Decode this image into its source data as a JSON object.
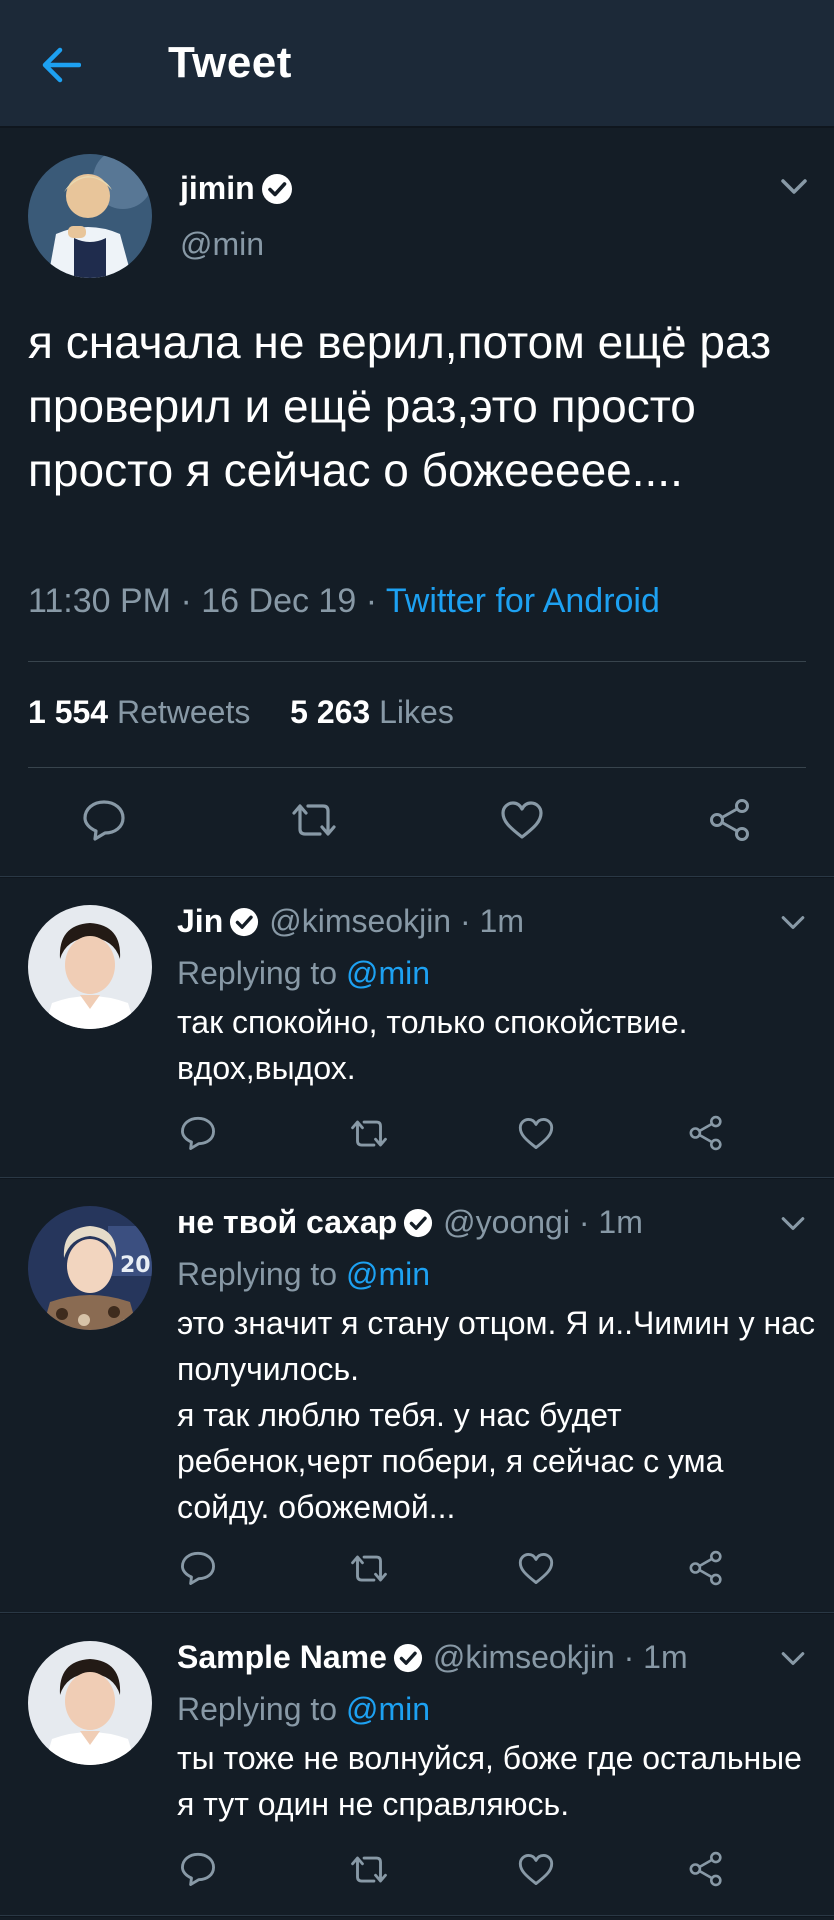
{
  "header": {
    "title": "Tweet"
  },
  "main_tweet": {
    "name": "jimin",
    "handle": "@min",
    "text": "я сначала не верил,потом ещё раз проверил и ещё раз,это просто просто я сейчас о божеееее....",
    "time": "11:30 PM",
    "date": "16 Dec 19",
    "separator": "·",
    "source": "Twitter for Android",
    "retweets_count": "1 554",
    "retweets_label": "Retweets",
    "likes_count": "5 263",
    "likes_label": "Likes"
  },
  "replies": [
    {
      "name": "Jin",
      "handle": "@kimseokjin · 1m",
      "replying_to_label": "Replying to",
      "replying_to": "@min",
      "lines": [
        "так спокойно, только спокойствие. вдох,выдох."
      ]
    },
    {
      "name": "не твой сахар",
      "handle": "@yoongi · 1m",
      "replying_to_label": "Replying to",
      "replying_to": "@min",
      "lines": [
        "это значит я стану отцом. Я и..Чимин у нас получилось.",
        "я так люблю тебя. у нас будет ребенок,черт побери, я сейчас с ума сойду. обожемой..."
      ]
    },
    {
      "name": "Sample Name",
      "handle": "@kimseokjin · 1m",
      "replying_to_label": "Replying to",
      "replying_to": "@min",
      "lines": [
        "ты тоже не волнуйся, боже где остальные я тут один не справляюсь."
      ]
    }
  ],
  "colors": {
    "background": "#141d26",
    "header": "#1c2938",
    "accent": "#1da1f2",
    "secondary_text": "#8899a6"
  },
  "icons": [
    "arrow-left-icon",
    "verified-badge-icon",
    "chevron-down-icon",
    "reply-icon",
    "retweet-icon",
    "like-icon",
    "share-icon"
  ]
}
